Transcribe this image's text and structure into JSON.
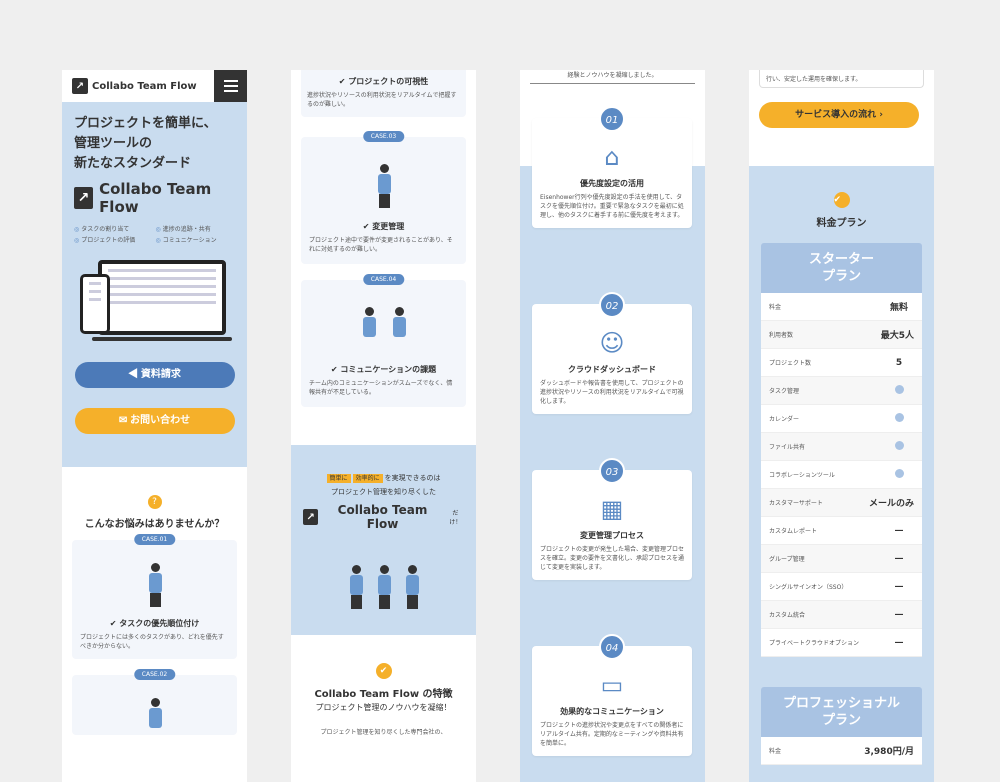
{
  "col1": {
    "brand": "Collabo Team Flow",
    "hero_line1": "プロジェクトを簡単に、",
    "hero_line2": "管理ツールの",
    "hero_line3": "新たなスタンダード",
    "hero_brand": "Collabo Team Flow",
    "features": [
      "タスクの割り当て",
      "進捗の追跡・共有",
      "プロジェクトの評価",
      "コミュニケーション"
    ],
    "btn_request": "資料請求",
    "btn_contact": "お問い合わせ",
    "q_icon": "?",
    "q_title": "こんなお悩みはありませんか？",
    "case1_tag": "CASE.01",
    "case1_title": "✔ タスクの優先順位付け",
    "case1_text": "プロジェクトには多くのタスクがあり、どれを優先すべきか分からない。",
    "case2_tag": "CASE.02"
  },
  "col2": {
    "top_title": "✔ プロジェクトの可視性",
    "top_text": "進捗状況やリソースの利用状況をリアルタイムで把握するのが難しい。",
    "case3_tag": "CASE.03",
    "case3_title": "✔ 変更管理",
    "case3_text": "プロジェクト途中で要件が変更されることがあり、それに対処するのが難しい。",
    "case4_tag": "CASE.04",
    "case4_title": "✔ コミュニケーションの課題",
    "case4_text": "チーム内のコミュニケーションがスムーズでなく、情報共有が不足している。",
    "hl1": "簡単に",
    "hl2": "効率的に",
    "line1": "を実現できるのは",
    "line2": "プロジェクト管理を知り尽くした",
    "brand": "Collabo Team Flow",
    "brand_suffix": "だけ！",
    "feat_title": "Collabo Team Flow の特徴",
    "feat_sub": "プロジェクト管理のノウハウを凝縮！",
    "feat_text": "プロジェクト管理を知り尽くした専門会社の、"
  },
  "col3": {
    "top_text": "経験とノウハウを凝縮しました。",
    "steps": [
      {
        "num": "01",
        "title": "優先度設定の活用",
        "text": "Eisenhower行列や優先度設定の手法を使用して、タスクを優先順位付け。重要で緊急なタスクを最初に処理し、他のタスクに着手する前に優先度を考えます。"
      },
      {
        "num": "02",
        "title": "クラウドダッシュボード",
        "text": "ダッシュボードや報告書を使用して、プロジェクトの進捗状況やリソースの利用状況をリアルタイムで可視化します。"
      },
      {
        "num": "03",
        "title": "変更管理プロセス",
        "text": "プロジェクトの変更が発生した場合、変更管理プロセスを確立。変更の要件を文書化し、承認プロセスを通じて変更を実装します。"
      },
      {
        "num": "04",
        "title": "効果的なコミュニケーション",
        "text": "プロジェクトの進捗状況や変更点をすべての関係者にリアルタイム共有。定期的なミーティングや資料共有を簡単に。"
      }
    ]
  },
  "col4": {
    "note": "行い、安定した運用を確保します。",
    "btn_flow": "サービス導入の流れ ›",
    "check": "✔",
    "plan_title": "料金プラン",
    "starter_l1": "スターター",
    "starter_l2": "プラン",
    "rows": [
      {
        "label": "料金",
        "value": "無料"
      },
      {
        "label": "利用者数",
        "value": "最大5人"
      },
      {
        "label": "プロジェクト数",
        "value": "5"
      },
      {
        "label": "タスク管理",
        "value": "dot"
      },
      {
        "label": "カレンダー",
        "value": "dot"
      },
      {
        "label": "ファイル共有",
        "value": "dot"
      },
      {
        "label": "コラボレーションツール",
        "value": "dot"
      },
      {
        "label": "カスタマーサポート",
        "value": "メールのみ"
      },
      {
        "label": "カスタムレポート",
        "value": "—"
      },
      {
        "label": "グループ管理",
        "value": "—"
      },
      {
        "label": "シングルサインオン（SSO）",
        "value": "—"
      },
      {
        "label": "カスタム統合",
        "value": "—"
      },
      {
        "label": "プライベートクラウドオプション",
        "value": "—"
      }
    ],
    "pro_l1": "プロフェッショナル",
    "pro_l2": "プラン",
    "pro_price_label": "料金",
    "pro_price": "3,980円/月"
  }
}
